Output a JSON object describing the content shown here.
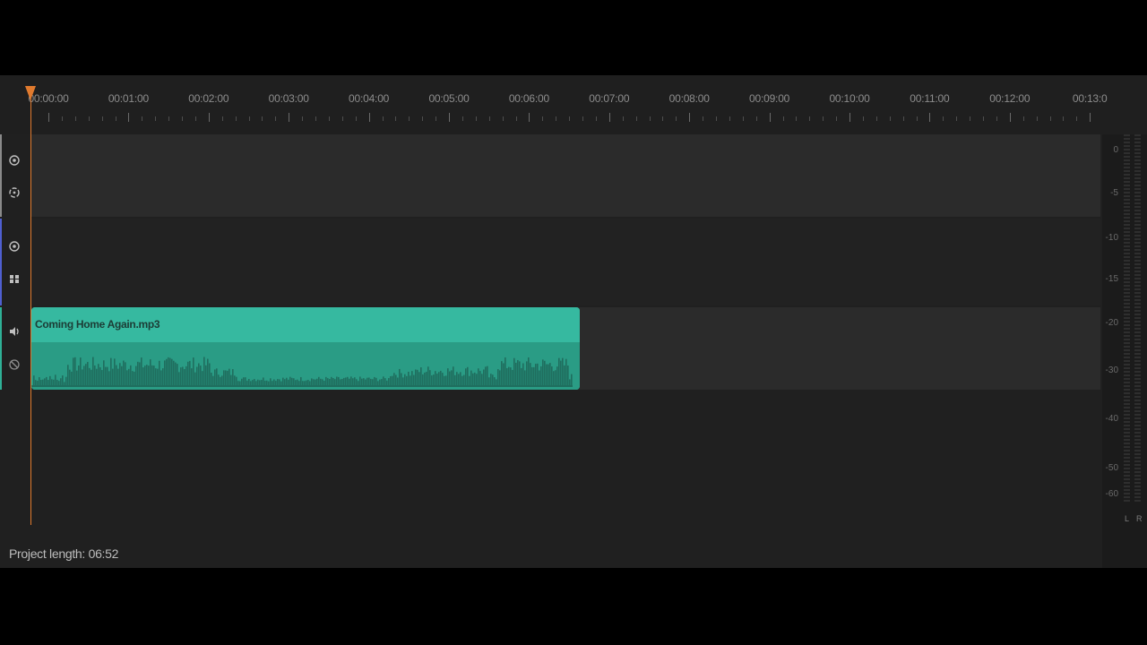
{
  "ruler": {
    "labels": [
      "00:00:00",
      "00:01:00",
      "00:02:00",
      "00:03:00",
      "00:04:00",
      "00:05:00",
      "00:06:00",
      "00:07:00",
      "00:08:00",
      "00:09:00",
      "00:10:00",
      "00:11:00",
      "00:12:00",
      "00:13:0"
    ]
  },
  "tracks": [
    {
      "id": "video",
      "accent": "#8a8a8a",
      "icons": [
        "eye-icon",
        "link-icon"
      ]
    },
    {
      "id": "overlay",
      "accent": "#4f5fd0",
      "icons": [
        "eye-icon",
        "effects-icon"
      ]
    },
    {
      "id": "audio",
      "accent": "#2fb096",
      "icons": [
        "speaker-icon",
        "unlink-icon"
      ]
    }
  ],
  "clip": {
    "name": "Coming Home Again.mp3",
    "color": "#33b39a"
  },
  "meter": {
    "db_scale": [
      "0",
      "-5",
      "-10",
      "-15",
      "-20",
      "-30",
      "-40",
      "-50",
      "-60"
    ],
    "left_label": "L",
    "right_label": "R"
  },
  "footer": {
    "project_length": "Project length: 06:52"
  },
  "colors": {
    "background": "#202020",
    "playhead": "#e07a2e",
    "clip": "#33b39a"
  }
}
